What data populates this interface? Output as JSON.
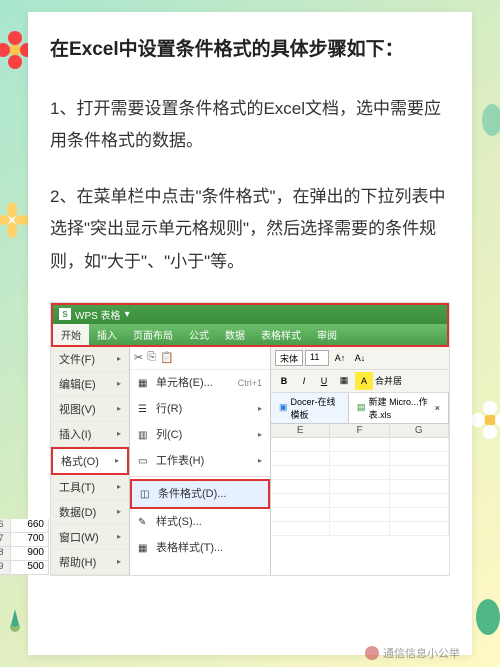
{
  "title": "在Excel中设置条件格式的具体步骤如下：",
  "steps": [
    "1、打开需要设置条件格式的Excel文档，选中需要应用条件格式的数据。",
    "2、在菜单栏中点击\"条件格式\"，在弹出的下拉列表中选择\"突出显示单元格规则\"，然后选择需要的条件规则，如\"大于\"、\"小于\"等。"
  ],
  "wps": {
    "brand": "WPS 表格",
    "dropdown_glyph": "▾",
    "ribbon": [
      "开始",
      "插入",
      "页面布局",
      "公式",
      "数据",
      "表格样式",
      "审阅"
    ],
    "menu": [
      {
        "label": "文件(F)"
      },
      {
        "label": "编辑(E)"
      },
      {
        "label": "视图(V)"
      },
      {
        "label": "插入(I)"
      },
      {
        "label": "格式(O)",
        "highlight": true
      },
      {
        "label": "工具(T)"
      },
      {
        "label": "数据(D)"
      },
      {
        "label": "窗口(W)"
      },
      {
        "label": "帮助(H)"
      }
    ],
    "submenu": [
      {
        "icon": "▦",
        "label": "单元格(E)...",
        "shortcut": "Ctrl+1"
      },
      {
        "icon": "☰",
        "label": "行(R)"
      },
      {
        "icon": "▥",
        "label": "列(C)"
      },
      {
        "icon": "▭",
        "label": "工作表(H)"
      },
      {
        "sep": true
      },
      {
        "icon": "◫",
        "label": "条件格式(D)...",
        "highlight": true
      },
      {
        "icon": "✎",
        "label": "样式(S)..."
      },
      {
        "icon": "▦",
        "label": "表格样式(T)..."
      }
    ],
    "font_toolbar": {
      "font": "宋体",
      "size": "11",
      "bold": "B",
      "italic": "I",
      "underline": "U",
      "merge": "合并居"
    },
    "docer": {
      "label": "Docer-在线模板",
      "file": "新建 Micro...作表.xls"
    },
    "columns": [
      "E",
      "F",
      "G"
    ],
    "data_rows": [
      {
        "n": "6",
        "v": "660"
      },
      {
        "n": "7",
        "v": "700"
      },
      {
        "n": "8",
        "v": "900"
      },
      {
        "n": "9",
        "v": "500"
      }
    ]
  },
  "watermark": "通信信息小公举"
}
